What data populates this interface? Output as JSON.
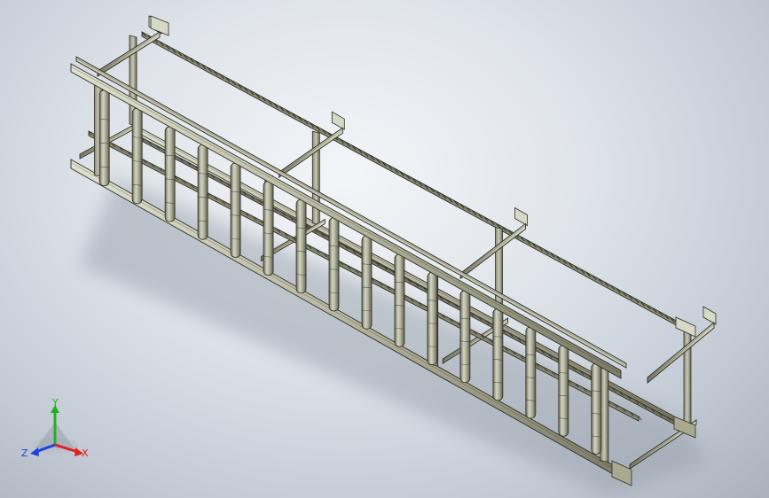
{
  "viewport": {
    "model": "roller-conveyor-frame-isometric",
    "colors": {
      "background_center": "#f3f5f8",
      "background_edge": "#a9b1bc",
      "metal_light": "#d8d8c6",
      "metal_mid": "#a9a992",
      "metal_dark": "#6e6e5c",
      "edge_line": "#2e2e25"
    }
  },
  "triad": {
    "x_label": "X",
    "y_label": "Y",
    "z_label": "Z",
    "x_color": "#e02020",
    "y_color": "#20b020",
    "z_color": "#2040e0"
  }
}
